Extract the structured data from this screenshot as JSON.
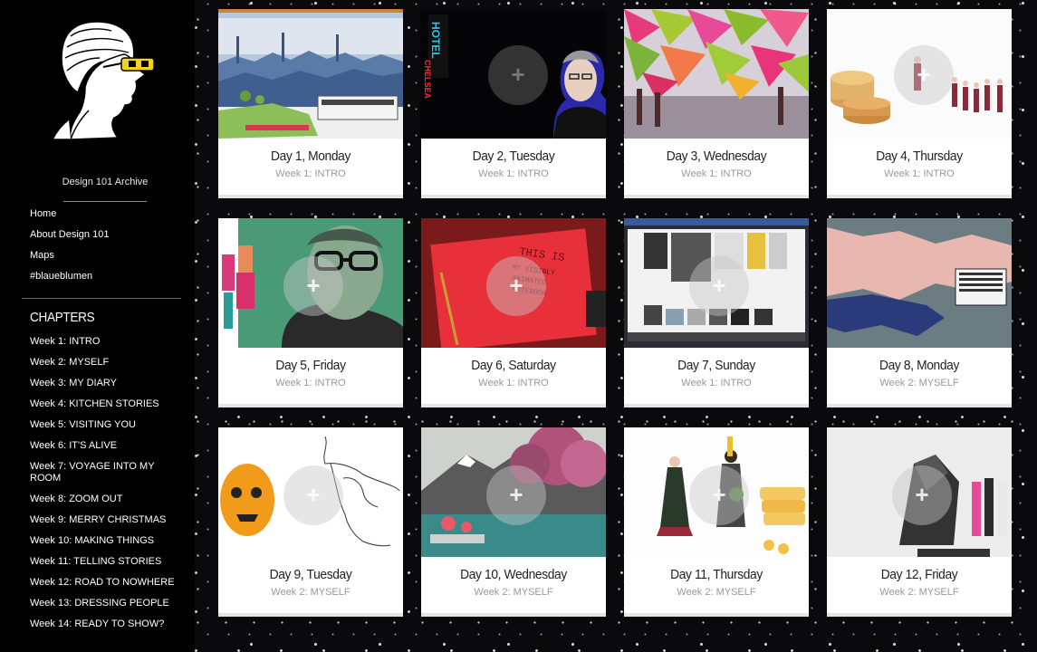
{
  "sidebar": {
    "archive_title": "Design 101 Archive",
    "nav": [
      "Home",
      "About Design 101",
      "Maps",
      "#blaueblumen"
    ],
    "chapters_title": "CHAPTERS",
    "chapters": [
      "Week 1: INTRO",
      "Week 2: MYSELF",
      "Week 3: MY DIARY",
      "Week 4: KITCHEN STORIES",
      "Week 5: VISITING YOU",
      "Week 6: IT'S ALIVE",
      "Week 7: VOYAGE INTO MY ROOM",
      "Week 8: ZOOM OUT",
      "Week 9: MERRY CHRISTMAS",
      "Week 10: MAKING THINGS",
      "Week 11: TELLING STORIES",
      "Week 12: ROAD TO NOWHERE",
      "Week 13: DRESSING PEOPLE",
      "Week 14: READY TO SHOW?"
    ]
  },
  "cards": [
    {
      "day": "Day 1, Monday",
      "week": "Week 1: INTRO"
    },
    {
      "day": "Day 2, Tuesday",
      "week": "Week 1: INTRO"
    },
    {
      "day": "Day 3, Wednesday",
      "week": "Week 1: INTRO"
    },
    {
      "day": "Day 4, Thursday",
      "week": "Week 1: INTRO"
    },
    {
      "day": "Day 5, Friday",
      "week": "Week 1: INTRO"
    },
    {
      "day": "Day 6, Saturday",
      "week": "Week 1: INTRO"
    },
    {
      "day": "Day 7, Sunday",
      "week": "Week 1: INTRO"
    },
    {
      "day": "Day 8, Monday",
      "week": "Week 2: MYSELF"
    },
    {
      "day": "Day 9, Tuesday",
      "week": "Week 2: MYSELF"
    },
    {
      "day": "Day 10, Wednesday",
      "week": "Week 2: MYSELF"
    },
    {
      "day": "Day 11, Thursday",
      "week": "Week 2: MYSELF"
    },
    {
      "day": "Day 12, Friday",
      "week": "Week 2: MYSELF"
    }
  ],
  "thumb_text": {
    "hotel_sign": "HOTEL",
    "hotel_sign2": "CHELSEA",
    "notebook": "THIS IS MY VISIBLY ANIMATED NOTEBOOK",
    "plus": "+"
  },
  "colors": {
    "background": "#0a0a0c",
    "sidebar": "#000000",
    "card": "#ffffff",
    "week_text": "#999999",
    "logo_glasses": "#f2d21a"
  }
}
